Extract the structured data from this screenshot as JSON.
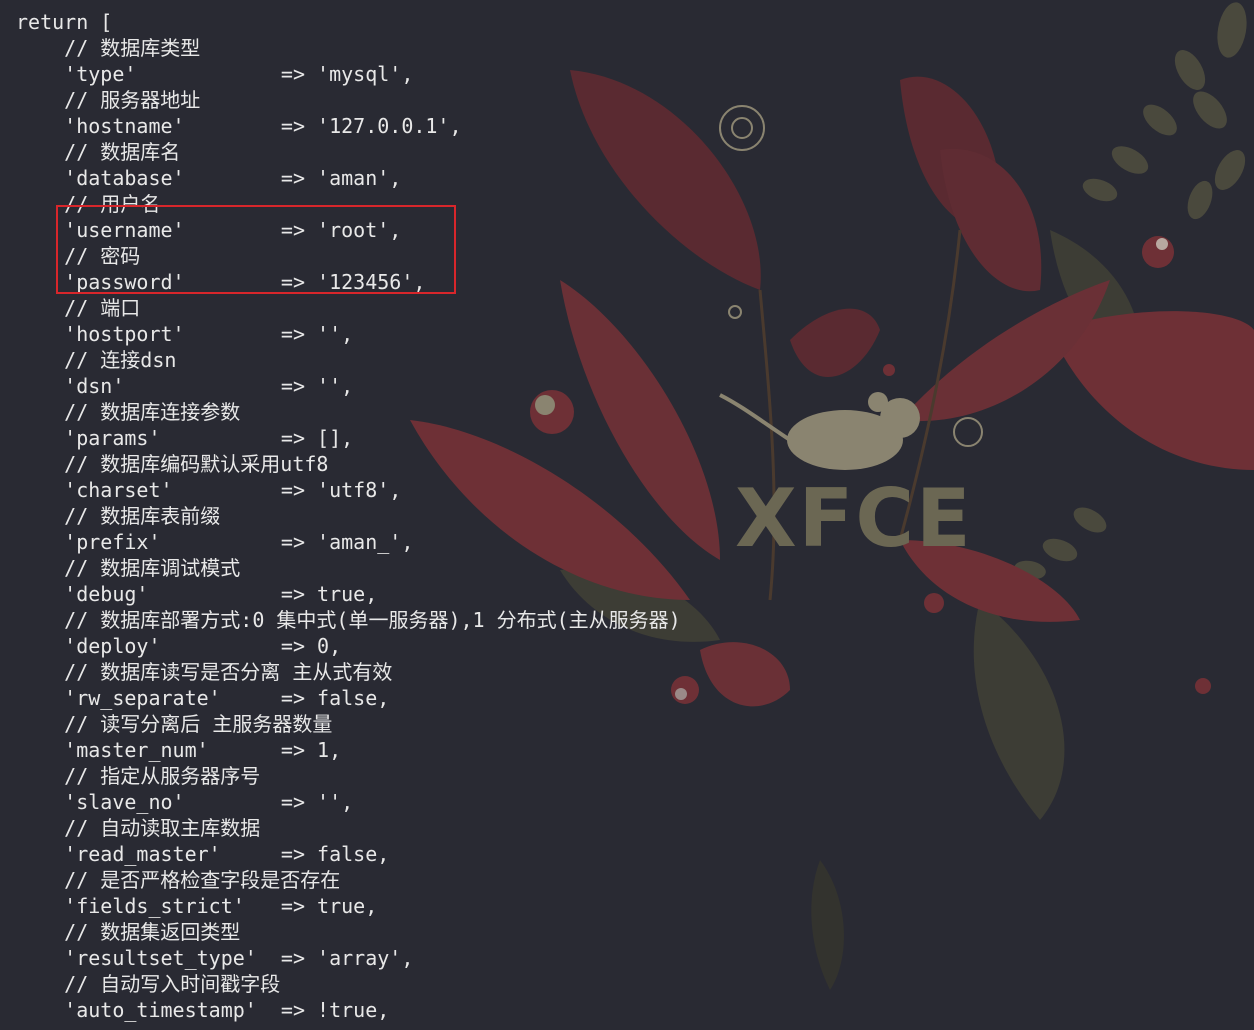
{
  "code_lines": [
    "return [",
    "    // 数据库类型",
    "    'type'            => 'mysql',",
    "    // 服务器地址",
    "    'hostname'        => '127.0.0.1',",
    "    // 数据库名",
    "    'database'        => 'aman',",
    "    // 用户名",
    "    'username'        => 'root',",
    "    // 密码",
    "    'password'        => '123456',",
    "    // 端口",
    "    'hostport'        => '',",
    "    // 连接dsn",
    "    'dsn'             => '',",
    "    // 数据库连接参数",
    "    'params'          => [],",
    "    // 数据库编码默认采用utf8",
    "    'charset'         => 'utf8',",
    "    // 数据库表前缀",
    "    'prefix'          => 'aman_',",
    "    // 数据库调试模式",
    "    'debug'           => true,",
    "    // 数据库部署方式:0 集中式(单一服务器),1 分布式(主从服务器)",
    "    'deploy'          => 0,",
    "    // 数据库读写是否分离 主从式有效",
    "    'rw_separate'     => false,",
    "    // 读写分离后 主服务器数量",
    "    'master_num'      => 1,",
    "    // 指定从服务器序号",
    "    'slave_no'        => '',",
    "    // 自动读取主库数据",
    "    'read_master'     => false,",
    "    // 是否严格检查字段是否存在",
    "    'fields_strict'   => true,",
    "    // 数据集返回类型",
    "    'resultset_type'  => 'array',",
    "    // 自动写入时间戳字段",
    "    'auto_timestamp'  => !true,"
  ],
  "wallpaper": {
    "logo_text": "XFCE",
    "icon": "xfce-mouse-icon"
  },
  "colors": {
    "background": "#292a33",
    "text": "#e8e8e8",
    "highlight_border": "#d8262b",
    "leaf_dark_red": "#5a2a31",
    "leaf_red": "#6e3036",
    "leaf_olive": "#45443a",
    "logo": "#6b6753"
  }
}
